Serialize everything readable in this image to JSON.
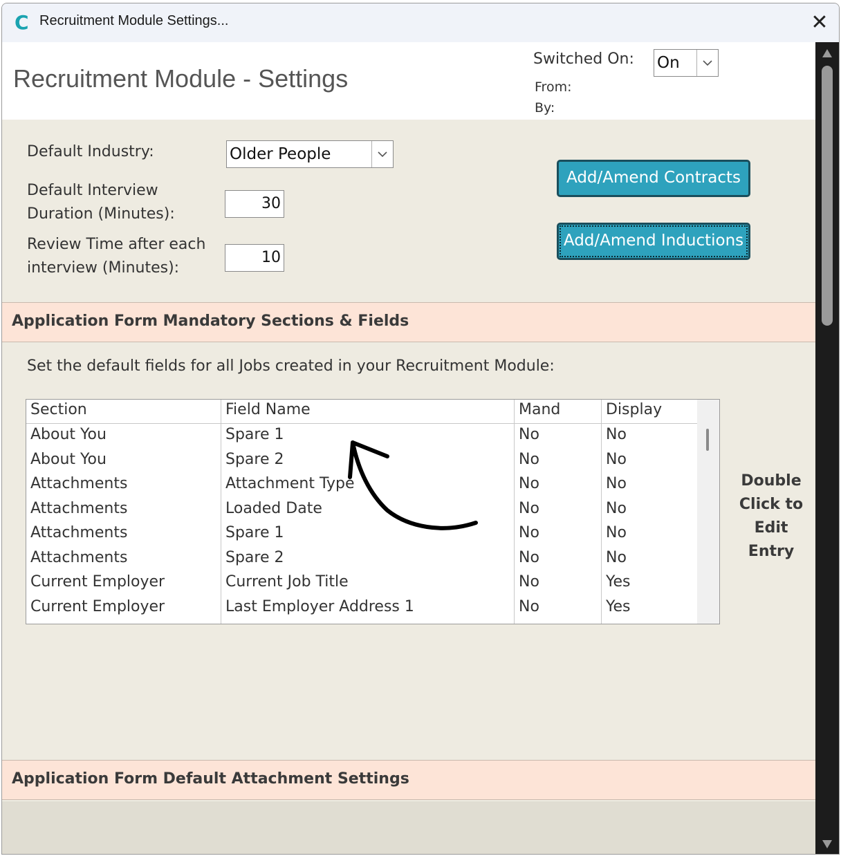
{
  "window": {
    "title": "Recruitment Module Settings...",
    "close_icon": "close-icon",
    "app_icon": "C"
  },
  "header": {
    "title": "Recruitment Module - Settings",
    "switched_on_label": "Switched On:",
    "switched_on_value": "On",
    "from_label": "From:",
    "by_label": "By:"
  },
  "settings": {
    "default_industry_label": "Default Industry:",
    "default_industry_value": "Older People",
    "interview_duration_label_1": "Default Interview",
    "interview_duration_label_2": "Duration (Minutes):",
    "interview_duration_value": "30",
    "review_time_label_1": "Review Time after each",
    "review_time_label_2": "interview (Minutes):",
    "review_time_value": "10",
    "contracts_button": "Add/Amend Contracts",
    "inductions_button": "Add/Amend Inductions"
  },
  "mandatory_section": {
    "title": "Application Form Mandatory Sections & Fields",
    "description": "Set the default fields for all Jobs created in your Recruitment Module:",
    "columns": [
      "Section",
      "Field Name",
      "Mand",
      "Display"
    ],
    "rows": [
      [
        "About You",
        "Spare 1",
        "No",
        "No"
      ],
      [
        "About You",
        "Spare 2",
        "No",
        "No"
      ],
      [
        "Attachments",
        "Attachment Type",
        "No",
        "No"
      ],
      [
        "Attachments",
        "Loaded Date",
        "No",
        "No"
      ],
      [
        "Attachments",
        "Spare 1",
        "No",
        "No"
      ],
      [
        "Attachments",
        "Spare 2",
        "No",
        "No"
      ],
      [
        "Current Employer",
        "Current Job Title",
        "No",
        "Yes"
      ],
      [
        "Current Employer",
        "Last Employer Address 1",
        "No",
        "Yes"
      ]
    ],
    "hint_lines": [
      "Double",
      "Click to",
      "Edit Entry"
    ]
  },
  "attachment_section": {
    "title": "Application Form Default Attachment Settings"
  },
  "colors": {
    "accent_button": "#2ea2bd",
    "section_bar": "#fde4d7",
    "content_bg": "#eeebe1"
  }
}
